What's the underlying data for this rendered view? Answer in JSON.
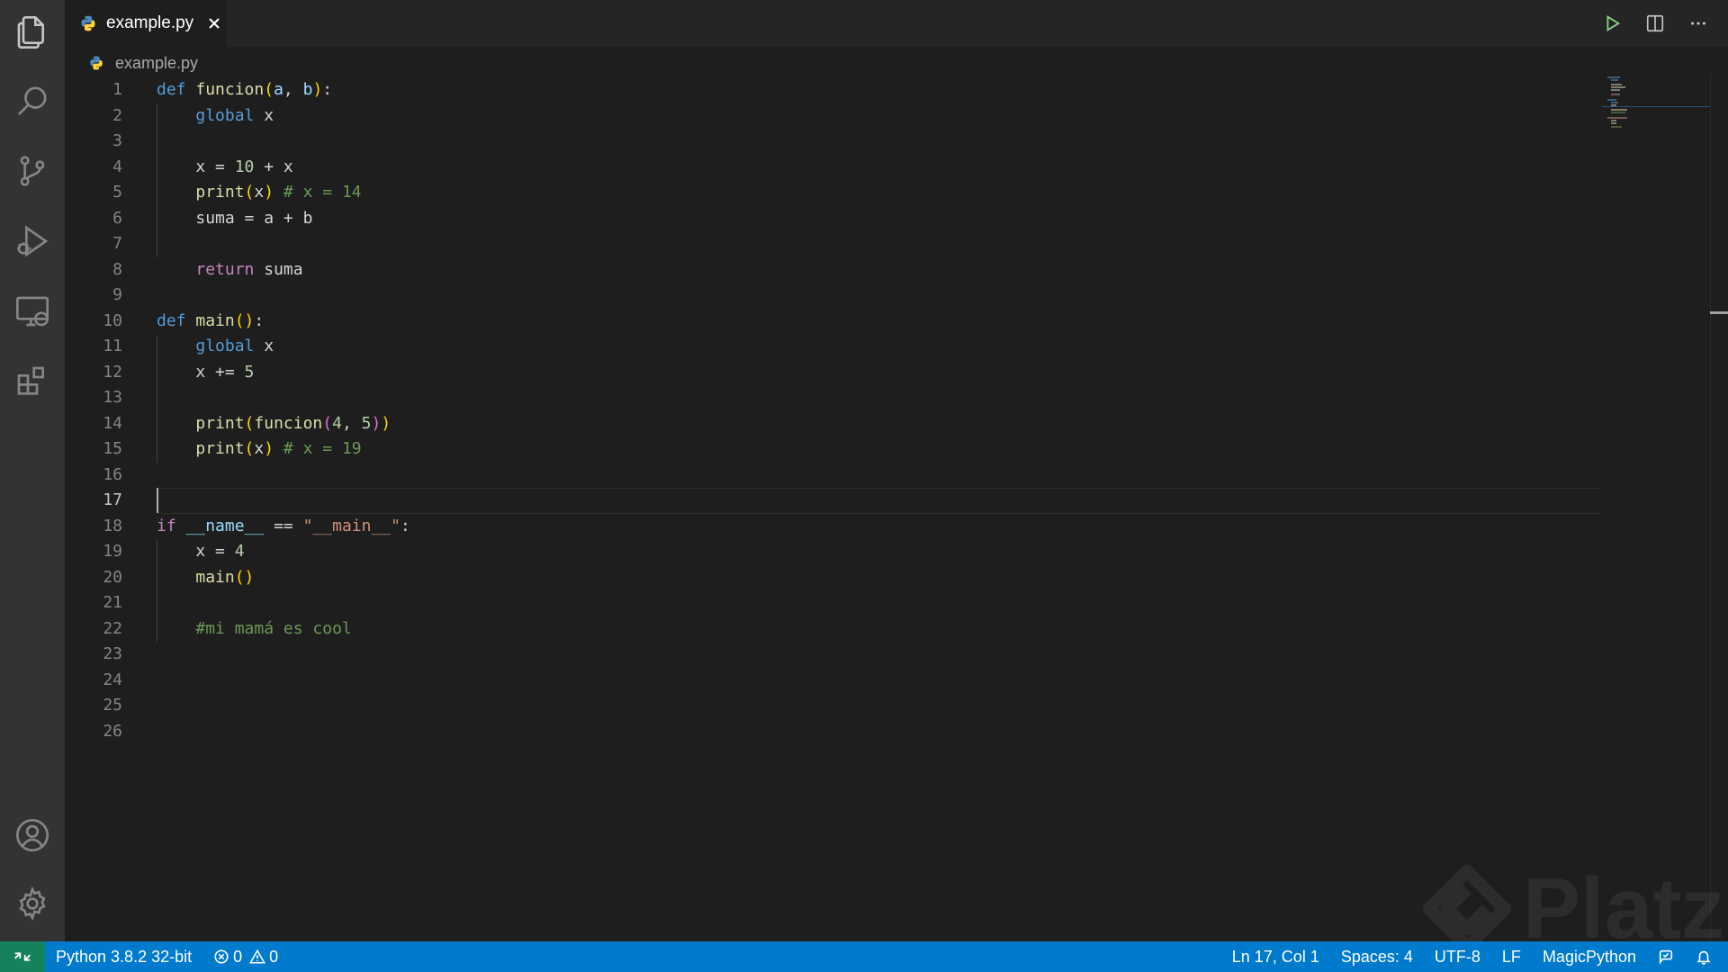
{
  "tab": {
    "label": "example.py"
  },
  "breadcrumb": {
    "label": "example.py"
  },
  "editor": {
    "line_numbers": [
      "1",
      "2",
      "3",
      "4",
      "5",
      "6",
      "7",
      "8",
      "9",
      "10",
      "11",
      "12",
      "13",
      "14",
      "15",
      "16",
      "17",
      "18",
      "19",
      "20",
      "21",
      "22",
      "23",
      "24",
      "25",
      "26"
    ],
    "current_line": 17,
    "lines": {
      "l1": {
        "kw": "def",
        "fn": "funcion",
        "p1": "a",
        "p2": "b"
      },
      "l2": {
        "kw": "global",
        "var": "x"
      },
      "l4": {
        "text1": "x = ",
        "num": "10",
        "text2": " + x"
      },
      "l5": {
        "fn": "print",
        "arg": "x",
        "cmt": "# x = 14"
      },
      "l6": {
        "text": "suma = a + b"
      },
      "l8": {
        "kw": "return",
        "var": "suma"
      },
      "l10": {
        "kw": "def",
        "fn": "main"
      },
      "l11": {
        "kw": "global",
        "var": "x"
      },
      "l12": {
        "text": "x += ",
        "num": "5"
      },
      "l14": {
        "fn1": "print",
        "fn2": "funcion",
        "n1": "4",
        "n2": "5"
      },
      "l15": {
        "fn": "print",
        "arg": "x",
        "cmt": "# x = 19"
      },
      "l18": {
        "kw": "if",
        "name": "__name__",
        "op": " == ",
        "str": "\"__main__\""
      },
      "l19": {
        "text": "x = ",
        "num": "4"
      },
      "l20": {
        "fn": "main"
      },
      "l22": {
        "cmt": "#mi mamá es cool"
      }
    }
  },
  "watermark": {
    "text": "Platzi"
  },
  "status_bar": {
    "interpreter": "Python 3.8.2 32-bit",
    "errors": "0",
    "warnings": "0",
    "cursor_position": "Ln 17, Col 1",
    "indentation": "Spaces: 4",
    "encoding": "UTF-8",
    "eol": "LF",
    "language": "MagicPython"
  },
  "colors": {
    "status_bar": "#007acc",
    "remote": "#16825d",
    "keyword": "#569cd6",
    "control": "#c586c0",
    "function": "#dcdcaa",
    "number": "#b5cea8",
    "string": "#ce9178",
    "comment": "#6a9955"
  },
  "icons": {
    "activity_bar": [
      "explorer-icon",
      "search-icon",
      "source-control-icon",
      "run-debug-icon",
      "remote-explorer-icon",
      "extensions-icon",
      "accounts-icon",
      "settings-gear-icon"
    ],
    "editor_actions": [
      "run-icon",
      "split-editor-icon",
      "more-actions-icon"
    ]
  }
}
